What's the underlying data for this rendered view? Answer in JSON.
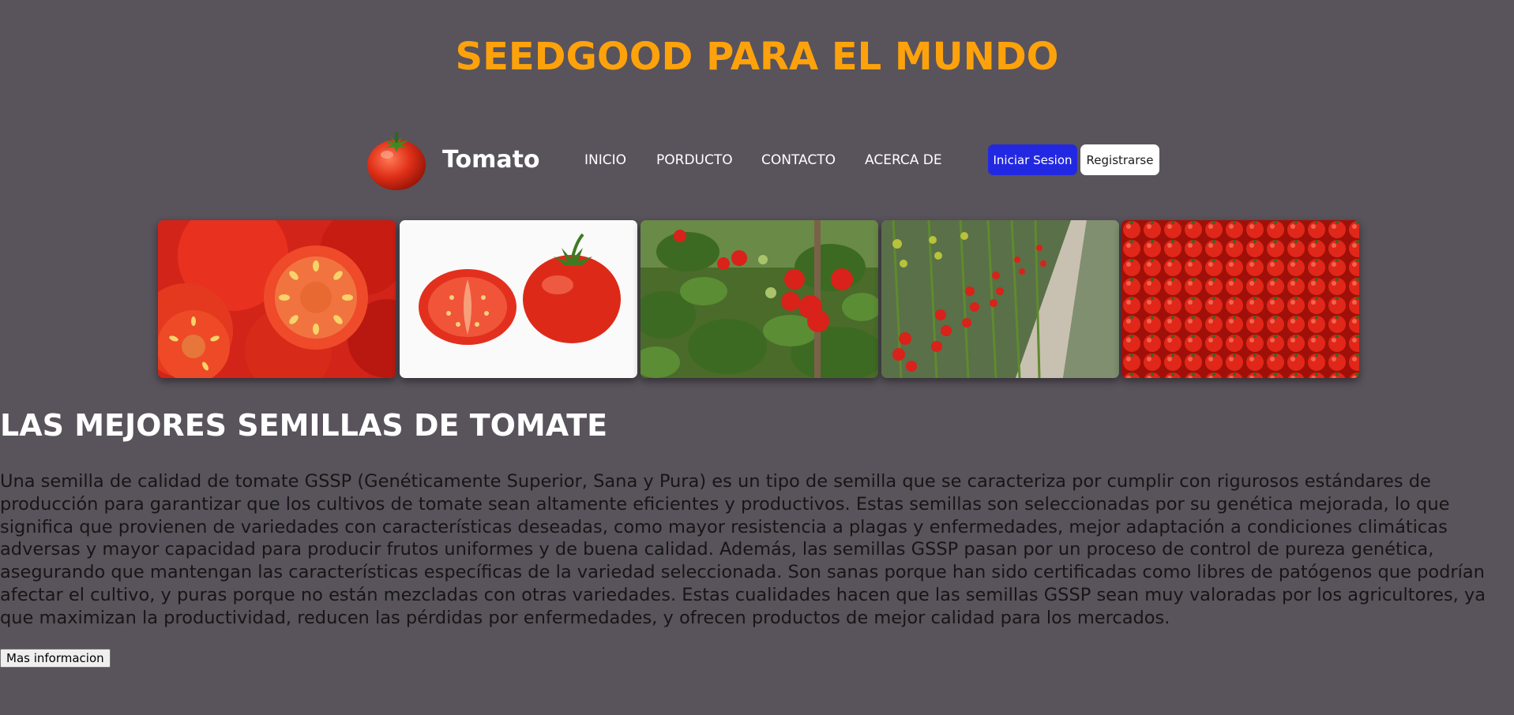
{
  "header": {
    "title": "SEEDGOOD PARA EL MUNDO"
  },
  "nav": {
    "logo_icon": "tomato-icon",
    "brand": "Tomato",
    "links": [
      "INICIO",
      "PORDUCTO",
      "CONTACTO",
      "ACERCA DE"
    ],
    "login_label": "Iniciar Sesion",
    "register_label": "Registrarse"
  },
  "gallery": {
    "images": [
      "tomato-halves-closeup",
      "tomato-cut-and-whole",
      "tomato-plant-vine",
      "greenhouse-tomato-rows",
      "cherry-tomato-pile"
    ]
  },
  "main": {
    "heading": "LAS MEJORES SEMILLAS DE TOMATE",
    "description": "Una semilla de calidad de tomate GSSP (Genéticamente Superior, Sana y Pura) es un tipo de semilla que se caracteriza por cumplir con rigurosos estándares de producción para garantizar que los cultivos de tomate sean altamente eficientes y productivos. Estas semillas son seleccionadas por su genética mejorada, lo que significa que provienen de variedades con características deseadas, como mayor resistencia a plagas y enfermedades, mejor adaptación a condiciones climáticas adversas y mayor capacidad para producir frutos uniformes y de buena calidad. Además, las semillas GSSP pasan por un proceso de control de pureza genética, asegurando que mantengan las características específicas de la variedad seleccionada. Son sanas porque han sido certificadas como libres de patógenos que podrían afectar el cultivo, y puras porque no están mezcladas con otras variedades. Estas cualidades hacen que las semillas GSSP sean muy valoradas por los agricultores, ya que maximizan la productividad, reducen las pérdidas por enfermedades, y ofrecen productos de mejor calidad para los mercados.",
    "more_button": "Mas informacion"
  },
  "colors": {
    "background": "#59535c",
    "title": "#fea20c",
    "login_button": "#2228e2",
    "register_button": "#ffffff"
  }
}
